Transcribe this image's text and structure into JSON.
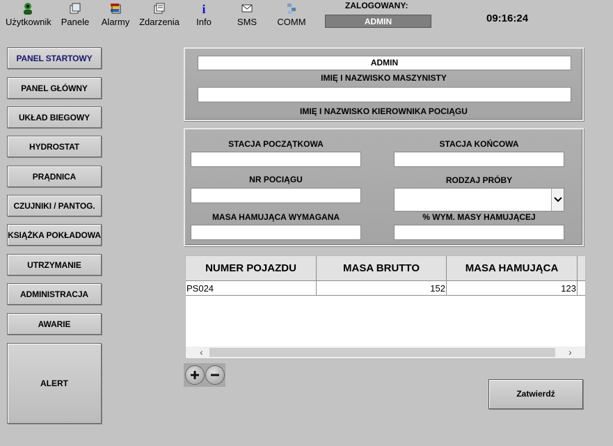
{
  "toolbar": {
    "user": "Użytkownik",
    "panels": "Panele",
    "alarms": "Alarmy",
    "events": "Zdarzenia",
    "info": "Info",
    "sms": "SMS",
    "comm": "COMM"
  },
  "login": {
    "label": "ZALOGOWANY:",
    "user": "ADMIN"
  },
  "clock": "09:16:24",
  "sidebar": [
    "PANEL STARTOWY",
    "PANEL GŁÓWNY",
    "UKŁAD BIEGOWY",
    "HYDROSTAT",
    "PRĄDNICA",
    "CZUJNIKI / PANTOG.",
    "KSIĄŻKA POKŁADOWA",
    "UTRZYMANIE",
    "ADMINISTRACJA",
    "AWARIE"
  ],
  "alert": "ALERT",
  "crew": {
    "driver_value": "ADMIN",
    "driver_label": "IMIĘ I NAZWISKO MASZYNISTY",
    "manager_value": "",
    "manager_label": "IMIĘ I NAZWISKO KIEROWNIKA POCIĄGU"
  },
  "trip": {
    "start_label": "STACJA POCZĄTKOWA",
    "start_value": "",
    "end_label": "STACJA KOŃCOWA",
    "end_value": "",
    "train_no_label": "NR POCIĄGU",
    "train_no_value": "",
    "test_type_label": "RODZAJ PRÓBY",
    "test_type_value": "",
    "brake_mass_label": "MASA HAMUJĄCA WYMAGANA",
    "brake_mass_value": "",
    "pct_label": "% WYM. MASY HAMUJĄCEJ",
    "pct_value": ""
  },
  "table": {
    "headers": [
      "NUMER POJAZDU",
      "MASA BRUTTO",
      "MASA HAMUJĄCA"
    ],
    "rows": [
      {
        "vehicle": "PS024",
        "gross": "152",
        "brake": "123"
      }
    ]
  },
  "confirm": "Zatwierdź"
}
